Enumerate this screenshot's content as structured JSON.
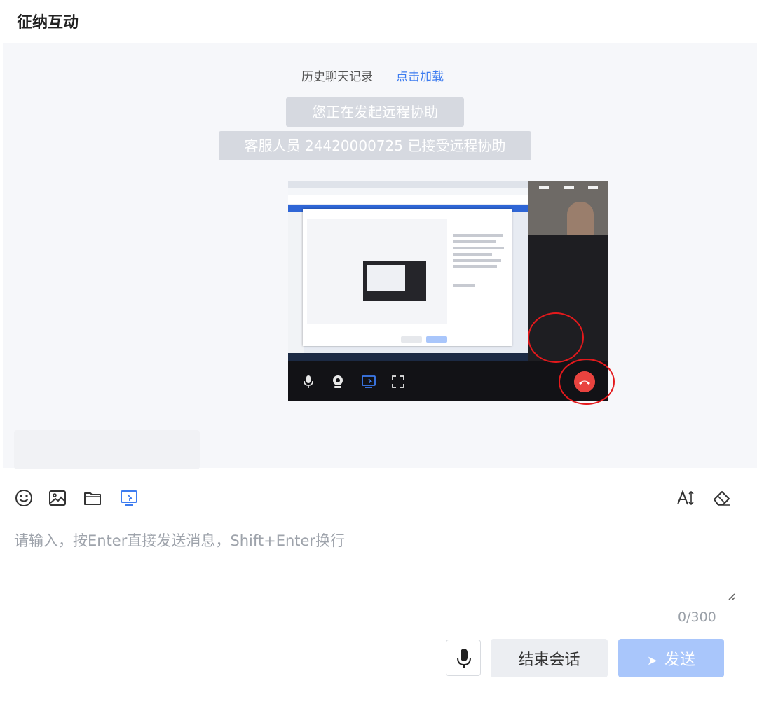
{
  "header": {
    "title": "征纳互动"
  },
  "chat": {
    "history_label": "历史聊天记录",
    "history_link": "点击加载",
    "system_messages": [
      "您正在发起远程协助",
      "客服人员 24420000725 已接受远程协助"
    ]
  },
  "toolbar": {
    "icons": [
      "emoji-icon",
      "image-icon",
      "folder-icon",
      "remote-assist-icon",
      "font-size-icon",
      "eraser-icon"
    ],
    "accent_color": "#3d7cf0"
  },
  "composer": {
    "placeholder": "请输入，按Enter直接发送消息，Shift+Enter换行",
    "value": "",
    "char_count": "0/300"
  },
  "actions": {
    "end_session_label": "结束会话",
    "send_label": "发送",
    "send_color": "#a9c6fb"
  },
  "annotation_color": "#e4191c"
}
